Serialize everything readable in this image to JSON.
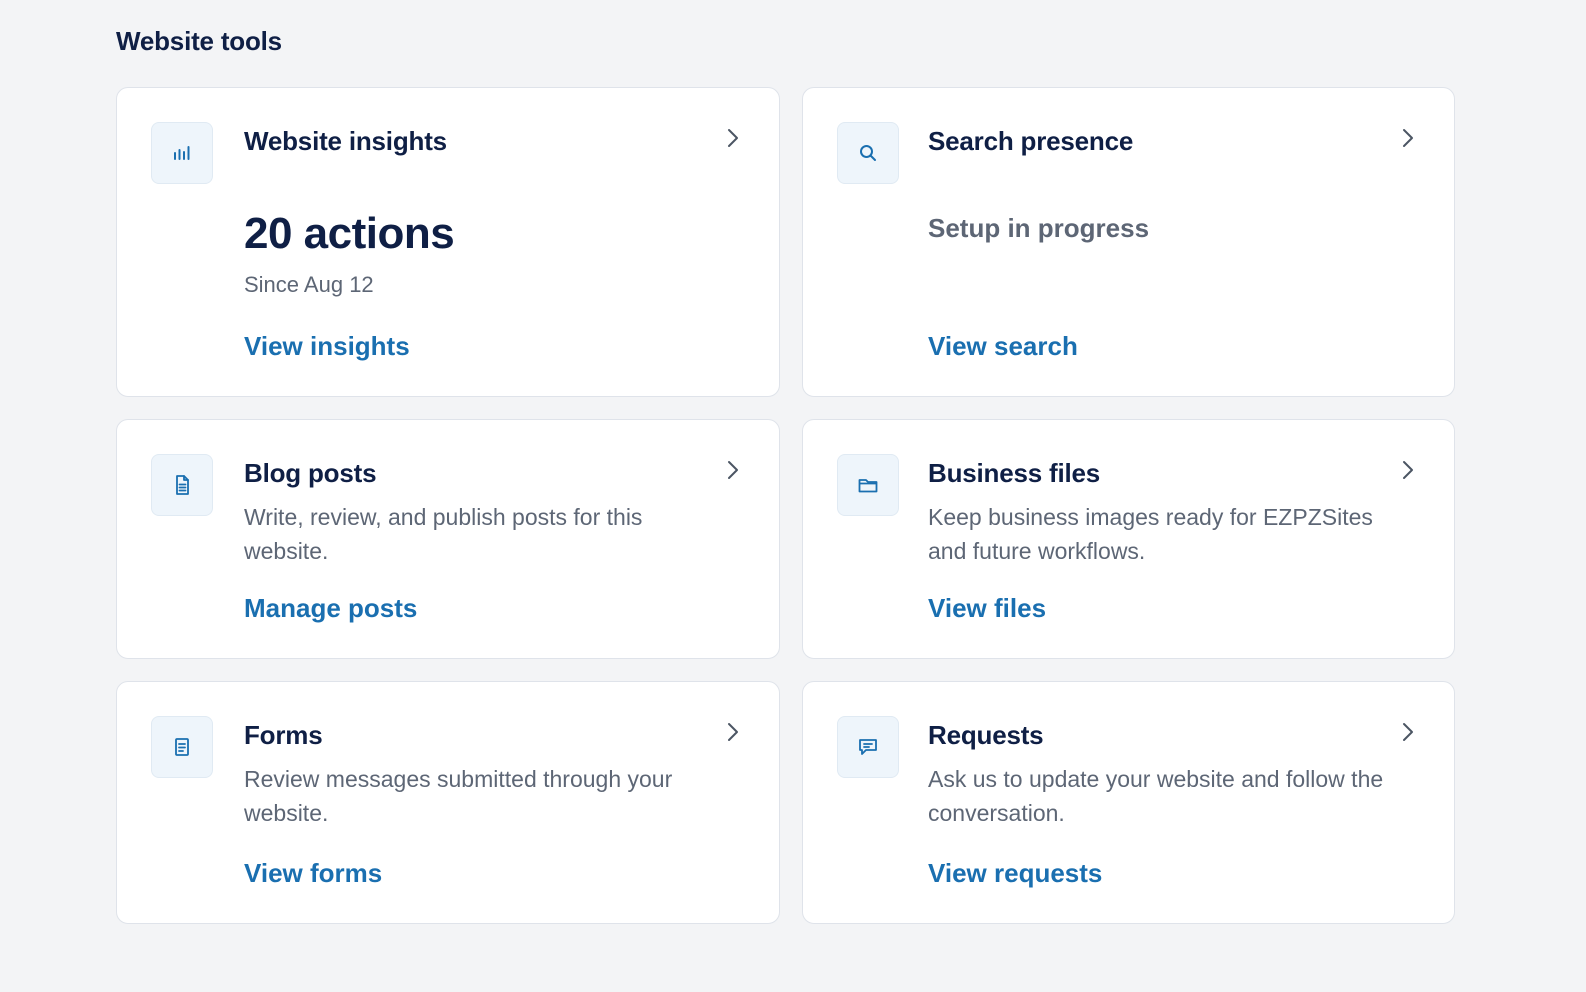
{
  "section": {
    "title": "Website tools"
  },
  "cards": {
    "insights": {
      "title": "Website insights",
      "icon": "bar-chart-icon",
      "metric": "20 actions",
      "metric_sub": "Since Aug 12",
      "link": "View insights"
    },
    "search": {
      "title": "Search presence",
      "icon": "search-icon",
      "status": "Setup in progress",
      "link": "View search"
    },
    "blog": {
      "title": "Blog posts",
      "icon": "document-icon",
      "description": "Write, review, and publish posts for this website.",
      "link": "Manage posts"
    },
    "files": {
      "title": "Business files",
      "icon": "folder-icon",
      "description": "Keep business images ready for EZPZSites and future workflows.",
      "link": "View files"
    },
    "forms": {
      "title": "Forms",
      "icon": "form-icon",
      "description": "Review messages submitted through your website.",
      "link": "View forms"
    },
    "requests": {
      "title": "Requests",
      "icon": "chat-icon",
      "description": "Ask us to update your website and follow the conversation.",
      "link": "View requests"
    }
  },
  "colors": {
    "background": "#f3f4f6",
    "card": "#ffffff",
    "heading": "#0f1f45",
    "muted": "#5d6675",
    "link": "#1a6fb0",
    "icon_tile": "#eef5fb"
  }
}
